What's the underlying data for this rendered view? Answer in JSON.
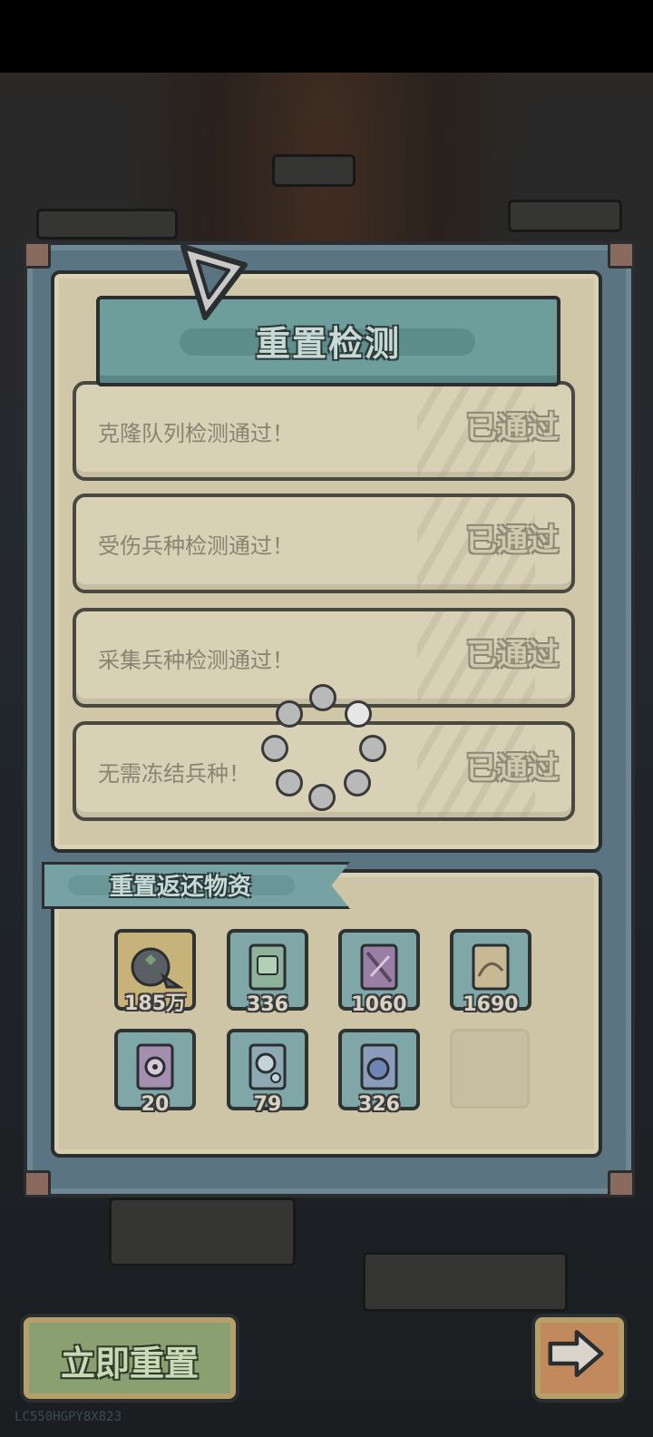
{
  "dialog": {
    "title": "重置检测",
    "checks": [
      {
        "text": "克隆队列检测通过！",
        "status": "已通过"
      },
      {
        "text": "受伤兵种检测通过！",
        "status": "已通过"
      },
      {
        "text": "采集兵种检测通过！",
        "status": "已通过"
      },
      {
        "text": "无需冻结兵种！",
        "status": "已通过"
      }
    ]
  },
  "rewards": {
    "title": "重置返还物资",
    "items": [
      {
        "icon": "gold-coin-bag-icon",
        "quantity": "185万"
      },
      {
        "icon": "green-manual-icon",
        "quantity": "336"
      },
      {
        "icon": "purple-manual-icon",
        "quantity": "1060"
      },
      {
        "icon": "tan-manual-icon",
        "quantity": "1690"
      },
      {
        "icon": "gear-manual-icon",
        "quantity": "20"
      },
      {
        "icon": "gear-blue-manual-icon",
        "quantity": "79"
      },
      {
        "icon": "blue-orb-manual-icon",
        "quantity": "326"
      }
    ]
  },
  "actions": {
    "reset_now_label": "立即重置",
    "next_icon": "arrow-right-icon"
  },
  "footer": {
    "device_code": "LC550HGPY8X823"
  }
}
